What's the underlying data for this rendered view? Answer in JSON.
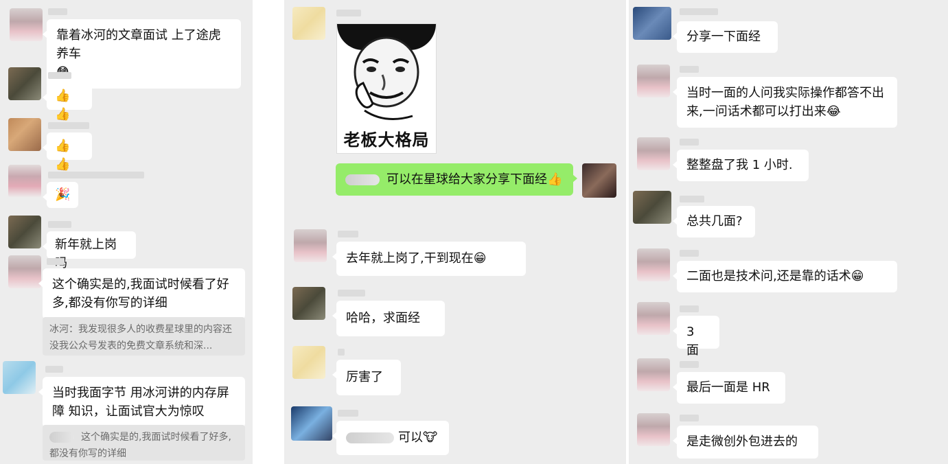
{
  "col1": {
    "messages": [
      {
        "text": "靠着冰河的文章面试 上了途虎养车",
        "emoji": "😳"
      },
      {
        "emoji": "👍👍"
      },
      {
        "emoji": "👍👍"
      },
      {
        "emoji": "🎉"
      },
      {
        "text": "新年就上岗吗"
      },
      {
        "text": "这个确实是的,我面试时候看了好多,都没有你写的详细",
        "quote": "冰河：我发现很多人的收费星球里的内容还没我公众号发表的免费文章系统和深..."
      },
      {
        "text": "当时我面字节 用冰河讲的内存屏障 知识，让面试官大为惊叹",
        "quote": "这个确实是的,我面试时候看了好多,都没有你写的详细"
      }
    ]
  },
  "col2": {
    "meme_caption": "老板大格局",
    "self_message": {
      "text": "可以在星球给大家分享下面经",
      "emoji": "👍"
    },
    "messages": [
      {
        "text": "去年就上岗了,干到现在",
        "emoji": "😁"
      },
      {
        "text": "哈哈，求面经"
      },
      {
        "text": "厉害了"
      },
      {
        "text": "可以",
        "emoji": "🐮"
      }
    ]
  },
  "col3": {
    "messages": [
      {
        "text": "分享一下面经"
      },
      {
        "text": "当时一面的人问我实际操作都答不出来,一问话术都可以打出来",
        "emoji": "😂"
      },
      {
        "text": "整整盘了我 1 小时."
      },
      {
        "text": "总共几面?"
      },
      {
        "text": "二面也是技术问,还是靠的话术",
        "emoji": "😁"
      },
      {
        "text": "3 面"
      },
      {
        "text": "最后一面是 HR"
      },
      {
        "text": "是走微创外包进去的"
      }
    ]
  },
  "colors": {
    "panel": "#ededed",
    "bubble": "#ffffff",
    "self_bubble": "#95ec69",
    "quote": "#e4e4e4"
  }
}
